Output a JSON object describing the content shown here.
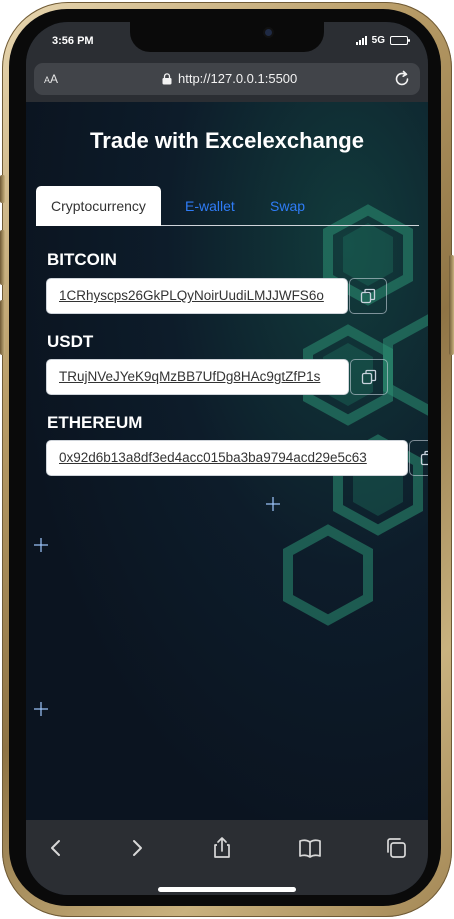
{
  "status": {
    "time": "3:56 PM",
    "network": "5G",
    "battery_level": 0.9
  },
  "browser": {
    "aa_label": "AA",
    "url": "http://127.0.0.1:5500"
  },
  "page": {
    "title": "Trade with Excelexchange",
    "tabs": [
      {
        "label": "Cryptocurrency",
        "active": true
      },
      {
        "label": "E-wallet",
        "active": false
      },
      {
        "label": "Swap",
        "active": false
      }
    ],
    "wallets": [
      {
        "label": "BITCOIN",
        "address": "1CRhyscps26GkPLQyNoirUudiLMJJWFS6o"
      },
      {
        "label": "USDT",
        "address": "TRujNVeJYeK9qMzBB7UfDg8HAc9gtZfP1s"
      },
      {
        "label": "ETHEREUM",
        "address": "0x92d6b13a8df3ed4acc015ba3ba9794acd29e5c63"
      }
    ]
  },
  "colors": {
    "accent": "#2f7cf6",
    "page_bg": "#0e1726",
    "toolbar_bg": "#2b2e33"
  },
  "icons": {
    "copy": "copy-icon",
    "reload": "reload-icon",
    "lock": "lock-icon",
    "toolbar": [
      "back-icon",
      "forward-icon",
      "share-icon",
      "bookmarks-icon",
      "tabs-icon"
    ]
  }
}
